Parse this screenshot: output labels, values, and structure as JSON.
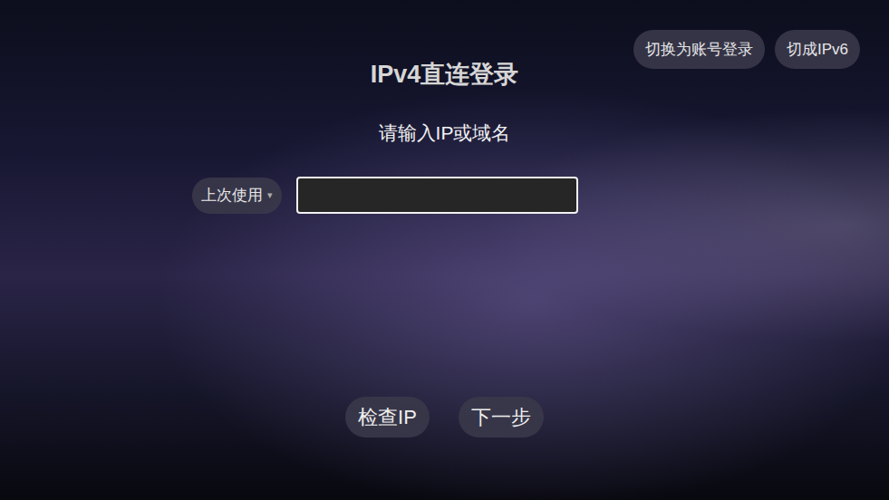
{
  "page": {
    "title": "IPv4直连登录",
    "subtitle": "请输入IP或域名"
  },
  "top_buttons": [
    {
      "label": "切换为账号登录"
    },
    {
      "label": "切成IPv6"
    }
  ],
  "last_used": {
    "label": "上次使用",
    "caret": "▾"
  },
  "input": {
    "value": "",
    "focused": true
  },
  "action_buttons": [
    {
      "label": "检查IP"
    },
    {
      "label": "下一步"
    }
  ]
}
